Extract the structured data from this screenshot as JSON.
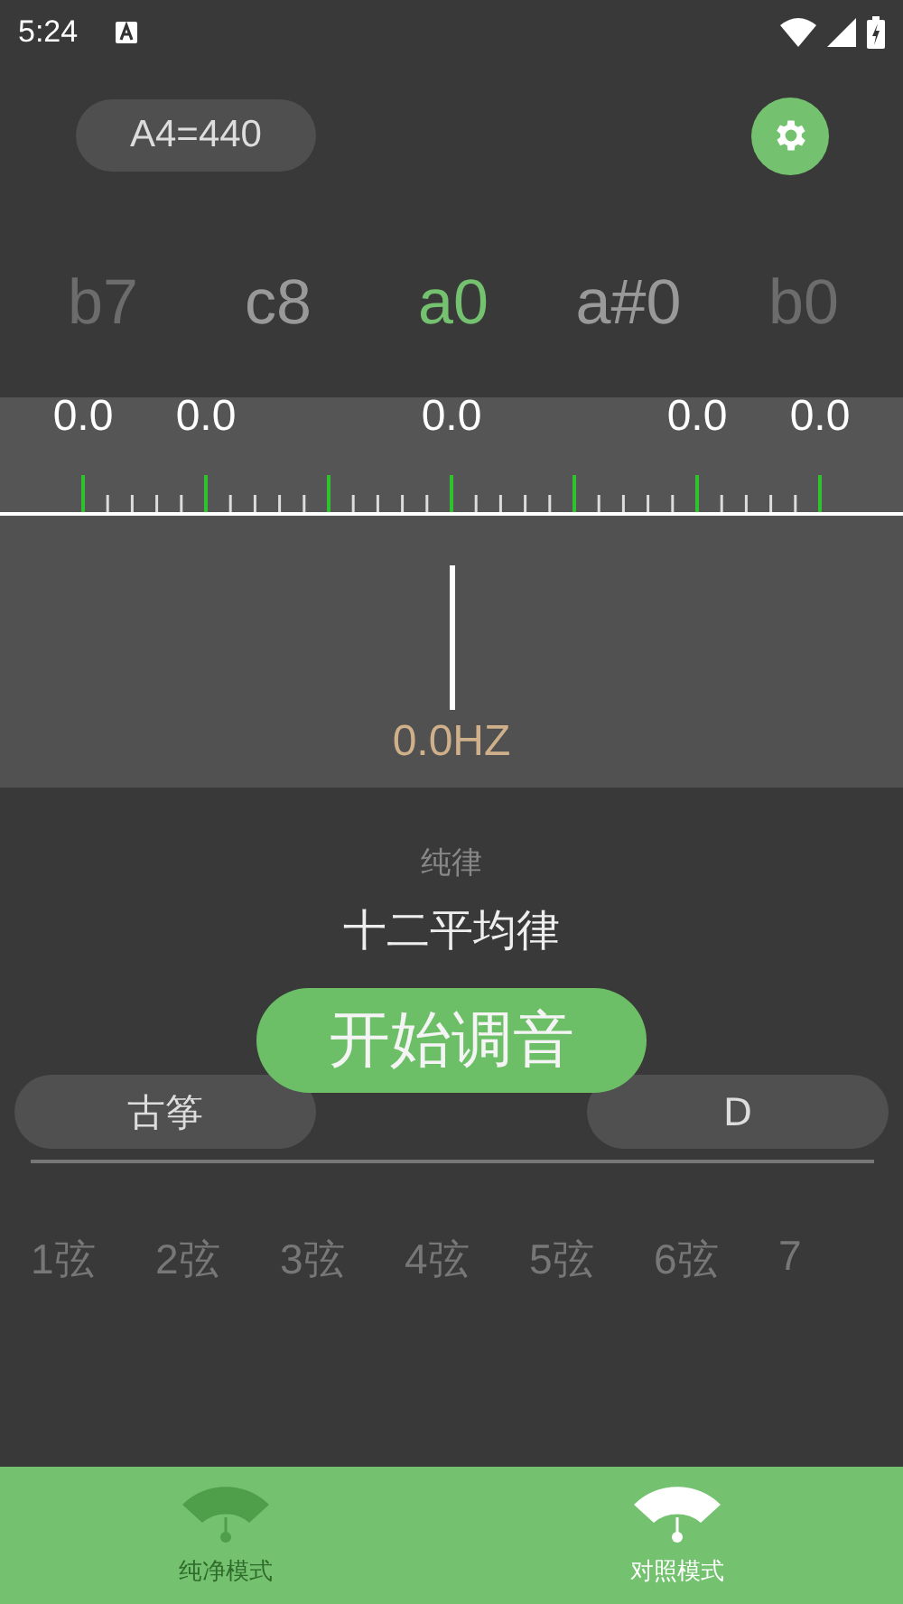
{
  "status_bar": {
    "time": "5:24"
  },
  "header": {
    "reference": "A4=440"
  },
  "notes": [
    {
      "label": "b7",
      "selected": false
    },
    {
      "label": "c8",
      "selected": false
    },
    {
      "label": "a0",
      "selected": true
    },
    {
      "label": "a#0",
      "selected": false
    },
    {
      "label": "b0",
      "selected": false
    }
  ],
  "meter": {
    "scale_labels": [
      "0.0",
      "0.0",
      "0.0",
      "0.0",
      "0.0"
    ],
    "frequency": "0.0HZ"
  },
  "temperaments": [
    {
      "label": "纯律",
      "selected": false
    },
    {
      "label": "十二平均律",
      "selected": true
    }
  ],
  "start_button": "开始调音",
  "instrument": "古筝",
  "key": "D",
  "strings": [
    "1弦",
    "2弦",
    "3弦",
    "4弦",
    "5弦",
    "6弦",
    "7"
  ],
  "tabs": [
    {
      "label": "纯净模式",
      "selected": false
    },
    {
      "label": "对照模式",
      "selected": true
    }
  ]
}
